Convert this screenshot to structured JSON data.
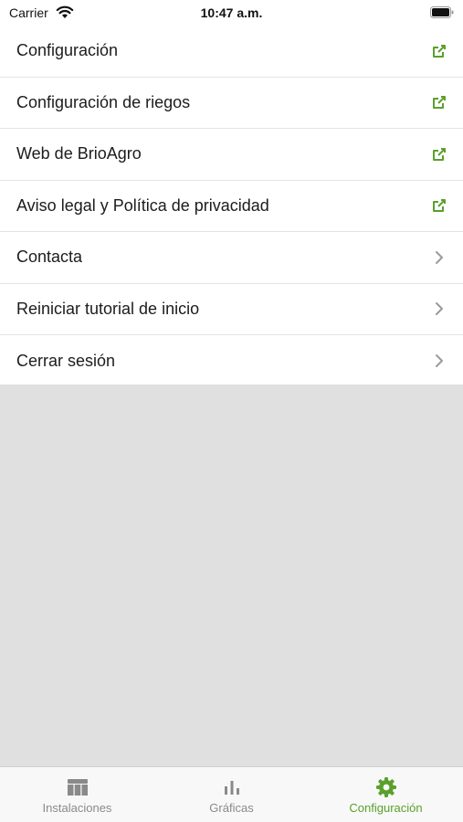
{
  "status_bar": {
    "carrier": "Carrier",
    "time": "10:47 a.m."
  },
  "menu": {
    "items": [
      {
        "label": "Configuración",
        "icon": "external-link-icon"
      },
      {
        "label": "Configuración de riegos",
        "icon": "external-link-icon"
      },
      {
        "label": "Web de BrioAgro",
        "icon": "external-link-icon"
      },
      {
        "label": "Aviso legal y Política de privacidad",
        "icon": "external-link-icon"
      },
      {
        "label": "Contacta",
        "icon": "chevron-right-icon"
      },
      {
        "label": "Reiniciar tutorial de inicio",
        "icon": "chevron-right-icon"
      },
      {
        "label": "Cerrar sesión",
        "icon": "chevron-right-icon"
      }
    ]
  },
  "tab_bar": {
    "tabs": [
      {
        "label": "Instalaciones",
        "icon": "table-icon",
        "active": false
      },
      {
        "label": "Gráficas",
        "icon": "bar-chart-icon",
        "active": false
      },
      {
        "label": "Configuración",
        "icon": "gear-icon",
        "active": true
      }
    ]
  },
  "colors": {
    "accent": "#5aa02c",
    "inactive": "#8a8a8a",
    "background": "#e0e0e0"
  }
}
